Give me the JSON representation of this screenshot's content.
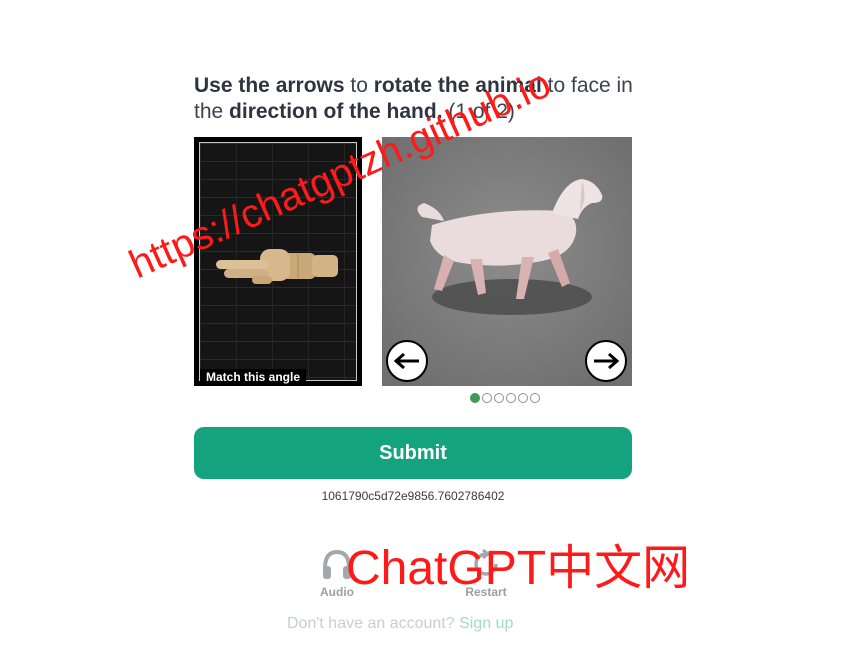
{
  "instruction": {
    "part1_bold": "Use the arrows",
    "part2": " to ",
    "part3_bold": "rotate the animal",
    "part4": " to face in the ",
    "part5_bold": "direction of the hand.",
    "part6": " (1 of 2)"
  },
  "reference_panel": {
    "label": "Match this angle",
    "icon": "pointing-hand-image"
  },
  "animal_panel": {
    "icon": "dog-3d-image",
    "left_arrow": "←",
    "right_arrow": "→"
  },
  "pagination": {
    "total": 6,
    "active_index": 0
  },
  "submit": {
    "label": "Submit"
  },
  "session_id": "1061790c5d72e9856.7602786402",
  "tools": {
    "audio_label": "Audio",
    "restart_label": "Restart"
  },
  "account": {
    "prompt": "Don't have an account?",
    "link": "Sign up"
  },
  "watermarks": {
    "diagonal": "https://chatgptzh.github.io",
    "corner": "ChatGPT中文网"
  },
  "colors": {
    "submit_bg": "#13a37f",
    "active_dot": "#3e9a56",
    "watermark": "#ff1a1a"
  }
}
